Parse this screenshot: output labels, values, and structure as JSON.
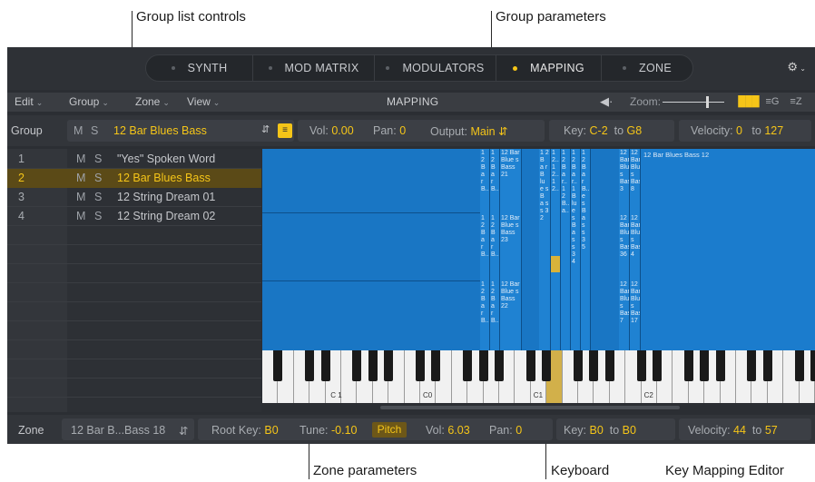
{
  "callouts": {
    "group_list_controls": "Group list controls",
    "group_parameters": "Group parameters",
    "zone_parameters": "Zone parameters",
    "keyboard": "Keyboard",
    "key_mapping_editor": "Key Mapping Editor"
  },
  "tabs": [
    "SYNTH",
    "MOD MATRIX",
    "MODULATORS",
    "MAPPING",
    "ZONE"
  ],
  "active_tab": "MAPPING",
  "menubar": {
    "edit": "Edit",
    "group": "Group",
    "zone": "Zone",
    "view": "View",
    "title": "MAPPING",
    "zoom_label": "Zoom:",
    "zoom_level": 0.7
  },
  "group_row": {
    "label": "Group",
    "m": "M",
    "s": "S",
    "name": "12 Bar Blues Bass",
    "vol_label": "Vol:",
    "vol_value": "0.00",
    "pan_label": "Pan:",
    "pan_value": "0",
    "output_label": "Output:",
    "output_value": "Main",
    "key_label": "Key:",
    "key_low": "C-2",
    "key_to": "to",
    "key_high": "G8",
    "vel_label": "Velocity:",
    "vel_low": "0",
    "vel_to": "to",
    "vel_high": "127"
  },
  "groups": [
    {
      "num": "1",
      "m": "M",
      "s": "S",
      "name": "\"Yes\" Spoken Word"
    },
    {
      "num": "2",
      "m": "M",
      "s": "S",
      "name": "12 Bar Blues Bass"
    },
    {
      "num": "3",
      "m": "M",
      "s": "S",
      "name": "12 String Dream 01"
    },
    {
      "num": "4",
      "m": "M",
      "s": "S",
      "name": "12 String Dream 02"
    }
  ],
  "selected_group": 1,
  "zone_big_label": "12 Bar Blues Bass 12",
  "zone_cells": [
    {
      "col": 0,
      "row": 0,
      "text": "1 2 B a r B.."
    },
    {
      "col": 1,
      "row": 0,
      "text": "1 2 B a r B.."
    },
    {
      "col": 2,
      "row": 0,
      "text": "12 Bar Blue s Bass 21"
    },
    {
      "col": 0,
      "row": 1,
      "text": "1 2 B a r B.."
    },
    {
      "col": 1,
      "row": 1,
      "text": "1 2 B a r B.."
    },
    {
      "col": 2,
      "row": 1,
      "text": "12 Bar Blue s Bass 23"
    },
    {
      "col": 0,
      "row": 2,
      "text": "1 2 B a r B.."
    },
    {
      "col": 1,
      "row": 2,
      "text": "1 2 B a r B.."
    },
    {
      "col": 2,
      "row": 2,
      "text": "12 Bar Blue s Bass 22"
    },
    {
      "col": 3,
      "row": 0,
      "text": "1 2 B a r B lu e s B a s s 3 2"
    },
    {
      "col": 4,
      "row": 0,
      "text": "1 2.. 1 2.. 1 2.."
    },
    {
      "col": 5,
      "row": 0,
      "text": "1 2 B a r.. 1 2 B.. a.."
    },
    {
      "col": 6,
      "row": 0,
      "text": "1 2 B a r.. 1 B lu e s B a s s 3 4"
    },
    {
      "col": 7,
      "row": 0,
      "text": "1 2 B a r B.. e s B a s s 3 5"
    },
    {
      "col": 8,
      "row": 0,
      "text": "12 Bar Blue s Bass 3"
    },
    {
      "col": 9,
      "row": 0,
      "text": "12 Bar Blue s Bass 8"
    },
    {
      "col": 8,
      "row": 1,
      "text": "12 Bar Blue s Bass 36"
    },
    {
      "col": 9,
      "row": 1,
      "text": "12 Bar Blue s Bass 4"
    },
    {
      "col": 8,
      "row": 2,
      "text": "12 Bar Blue s Bass 7"
    },
    {
      "col": 9,
      "row": 2,
      "text": "12 Bar Blue s Bass 17"
    }
  ],
  "keyboard": {
    "labels": [
      "C 1",
      "C0",
      "C1",
      "C2"
    ]
  },
  "zone_row": {
    "label": "Zone",
    "name": "12 Bar B...Bass 18",
    "root_label": "Root Key:",
    "root_value": "B0",
    "tune_label": "Tune:",
    "tune_value": "-0.10",
    "pitch": "Pitch",
    "vol_label": "Vol:",
    "vol_value": "6.03",
    "pan_label": "Pan:",
    "pan_value": "0",
    "key_label": "Key:",
    "key_low": "B0",
    "key_to": "to",
    "key_high": "B0",
    "vel_label": "Velocity:",
    "vel_low": "44",
    "vel_to": "to",
    "vel_high": "57"
  },
  "colors": {
    "accent": "#f5c518",
    "editor_blue": "#1976c4",
    "background": "#2b2e33"
  },
  "icons": [
    "speaker-icon",
    "gear-icon",
    "piano-icon",
    "list-icon",
    "sort-icon",
    "stepper-icon"
  ]
}
